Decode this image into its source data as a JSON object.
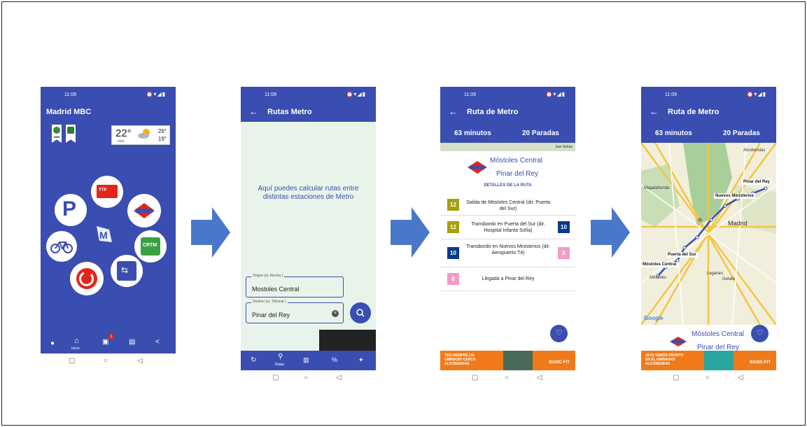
{
  "colors": {
    "primary": "#3a4db0",
    "light_bg": "#e8f4ea",
    "ad_orange": "#f07a1a",
    "line12": "#a4a10e",
    "line10": "#0a3a8c",
    "line8": "#f29bc7",
    "metro_red": "#e1251b"
  },
  "status": {
    "time": "11:09",
    "icons": "⏰▾◢▮"
  },
  "android_nav": {
    "back_icon": "◁",
    "home_icon": "○",
    "recents_icon": "▢"
  },
  "screen1": {
    "title": "Madrid MBC",
    "badge_fuel_price": "350€",
    "weather": {
      "temp": "22°",
      "more": "más",
      "high": "26°",
      "low": "19°"
    },
    "bottom_nav": {
      "home_label": "Inicio",
      "notif_count": "1"
    }
  },
  "screen2": {
    "title": "Rutas Metro",
    "info_text": "Aquí puedes calcular rutas entre distintas estaciones de Metro",
    "origin": {
      "label": "Origen (ej. Atocha )",
      "value": "Mostoles Central"
    },
    "destination": {
      "label": "Destino (ej. Tribunal )",
      "value": "Pinar del Rey"
    },
    "bottom_nav": {
      "routes_label": "Rutas"
    }
  },
  "screen3": {
    "title": "Ruta de Metro",
    "duration": "63 minutos",
    "stops": "20 Paradas",
    "map_label": "San Sebas",
    "from": "Móstoles Central",
    "to": "Pinar del Rey",
    "details_title": "DETALLES DE LA RUTA",
    "steps": [
      {
        "line_start": "12",
        "text": "Salida de Móstoles Central (dir. Puerta del Sur)",
        "line_end": ""
      },
      {
        "line_start": "12",
        "text": "Transbordo en Puerta del Sur (dir. Hospital Infanta Sofía)",
        "line_end": "10"
      },
      {
        "line_start": "10",
        "text": "Transbordo en Nuevos Ministerios (dir. Aeropuerto T4)",
        "line_end": "8"
      },
      {
        "line_start": "8",
        "text": "Llegada a Pinar del Rey",
        "line_end": ""
      }
    ],
    "ad": {
      "text": "TEN SIEMPRE UN GIMNASIO CERCA ALCOBENDAS",
      "brand": "BASIC-FIT"
    }
  },
  "screen4": {
    "title": "Ruta de Metro",
    "duration": "63 minutos",
    "stops": "20 Paradas",
    "map_labels": {
      "pinar": "Pinar del Rey",
      "nuevos": "Nuevos Ministerios",
      "puerta": "Puerta del Sur",
      "mostoles_central": "Móstoles Central",
      "alcobendas": "Alcobendas",
      "majadahonda": "Majadahonda",
      "madrid": "Madrid",
      "leganes": "Leganés",
      "getafe": "Getafe",
      "mostoles": "Móstoles",
      "google": "Google"
    },
    "from": "Móstoles Central",
    "to": "Pinar del Rey",
    "ad": {
      "text": "¡NOS VEMOS PRONTO EN EL GIMNASIO! ALCOBENDAS",
      "brand": "BASIC-FIT"
    }
  }
}
